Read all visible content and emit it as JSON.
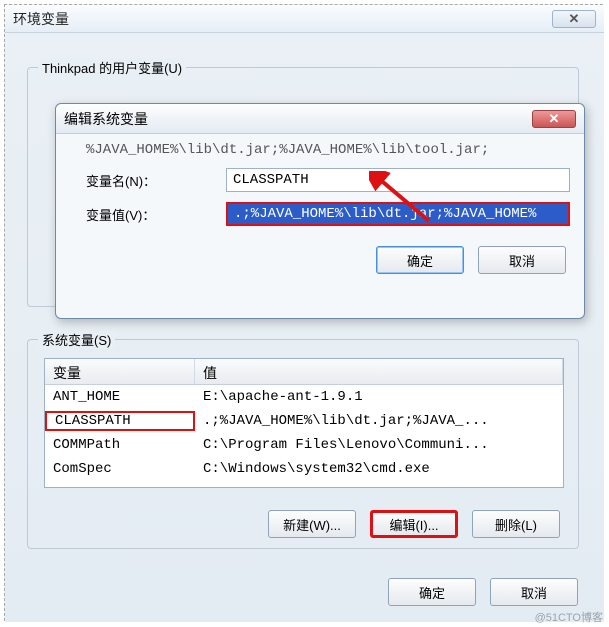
{
  "main_window": {
    "title": "环境变量",
    "close_glyph": "✕"
  },
  "user_vars": {
    "legend": "Thinkpad 的用户变量(U)"
  },
  "dialog": {
    "title": "编辑系统变量",
    "close_glyph": "✕",
    "hint": "%JAVA_HOME%\\lib\\dt.jar;%JAVA_HOME%\\lib\\tool.jar;",
    "name_label": "变量名(N)：",
    "name_value": "CLASSPATH",
    "value_label": "变量值(V)：",
    "value_value": ".;%JAVA_HOME%\\lib\\dt.jar;%JAVA_HOME%",
    "ok": "确定",
    "cancel": "取消"
  },
  "sys_vars": {
    "legend": "系统变量(S)",
    "col_var": "变量",
    "col_val": "值",
    "rows": [
      {
        "name": "ANT_HOME",
        "value": "E:\\apache-ant-1.9.1"
      },
      {
        "name": "CLASSPATH",
        "value": ".;%JAVA_HOME%\\lib\\dt.jar;%JAVA_..."
      },
      {
        "name": "COMMPath",
        "value": "C:\\Program Files\\Lenovo\\Communi..."
      },
      {
        "name": "ComSpec",
        "value": "C:\\Windows\\system32\\cmd.exe"
      }
    ],
    "new": "新建(W)...",
    "edit": "编辑(I)...",
    "delete": "删除(L)"
  },
  "bottom": {
    "ok": "确定",
    "cancel": "取消"
  },
  "watermark": "@51CTO博客"
}
